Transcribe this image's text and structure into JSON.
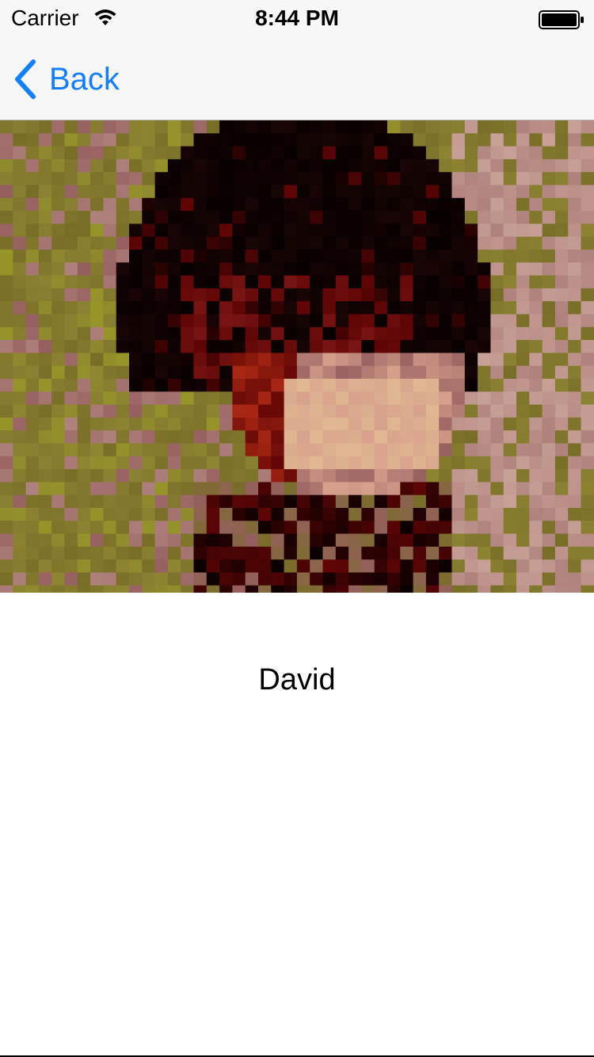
{
  "status_bar": {
    "carrier": "Carrier",
    "time": "8:44 PM",
    "wifi_icon": "wifi-icon",
    "battery_icon": "battery-icon"
  },
  "nav": {
    "back_label": "Back",
    "back_icon": "chevron-left-icon",
    "accent_color": "#157efb"
  },
  "photo": {
    "icon": "pixelated-portrait-photo"
  },
  "person": {
    "name": "David"
  }
}
